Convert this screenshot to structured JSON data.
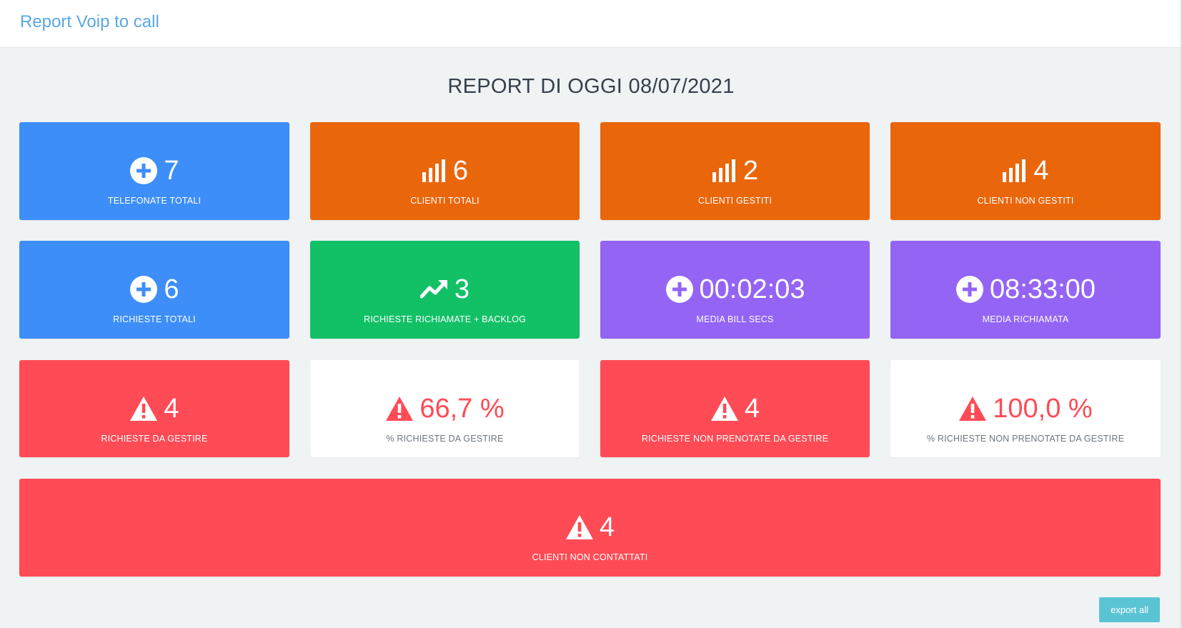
{
  "header": {
    "title": "Report Voip to call"
  },
  "report": {
    "title": "REPORT DI OGGI 08/07/2021"
  },
  "tiles": {
    "telefonate_totali": {
      "value": "7",
      "label": "TELEFONATE TOTALI",
      "icon": "plus-circle-icon",
      "color": "#3d8ef8"
    },
    "clienti_totali": {
      "value": "6",
      "label": "CLIENTI TOTALI",
      "icon": "bar-chart-icon",
      "color": "#ea660b"
    },
    "clienti_gestiti": {
      "value": "2",
      "label": "CLIENTI GESTITI",
      "icon": "bar-chart-icon",
      "color": "#ea660b"
    },
    "clienti_non_gestiti": {
      "value": "4",
      "label": "CLIENTI NON GESTITI",
      "icon": "bar-chart-icon",
      "color": "#ea660b"
    },
    "richieste_totali": {
      "value": "6",
      "label": "RICHIESTE TOTALI",
      "icon": "plus-circle-icon",
      "color": "#3d8ef8"
    },
    "richieste_richiamate": {
      "value": "3",
      "label": "RICHIESTE RICHIAMATE + BACKLOG",
      "icon": "trending-up-icon",
      "color": "#12c066"
    },
    "media_bill_secs": {
      "value": "00:02:03",
      "label": "MEDIA BILL SECS",
      "icon": "plus-circle-icon",
      "color": "#9464f5"
    },
    "media_richiamata": {
      "value": "08:33:00",
      "label": "MEDIA RICHIAMATA",
      "icon": "plus-circle-icon",
      "color": "#9464f5"
    },
    "richieste_da_gestire": {
      "value": "4",
      "label": "RICHIESTE DA GESTIRE",
      "icon": "warning-icon",
      "color": "#ff4b55"
    },
    "pct_richieste_da_gestire": {
      "value": "66,7 %",
      "label": "% RICHIESTE DA GESTIRE",
      "icon": "warning-icon",
      "color": "#ff4b55"
    },
    "richieste_non_prenotate": {
      "value": "4",
      "label": "RICHIESTE NON PRENOTATE DA GESTIRE",
      "icon": "warning-icon",
      "color": "#ff4b55"
    },
    "pct_richieste_non_prenotate": {
      "value": "100,0 %",
      "label": "% RICHIESTE NON PRENOTATE DA GESTIRE",
      "icon": "warning-icon",
      "color": "#ff4b55"
    },
    "clienti_non_contattati": {
      "value": "4",
      "label": "CLIENTI NON CONTATTATI",
      "icon": "warning-icon",
      "color": "#ff4b55"
    }
  },
  "actions": {
    "export_label": "export all"
  }
}
